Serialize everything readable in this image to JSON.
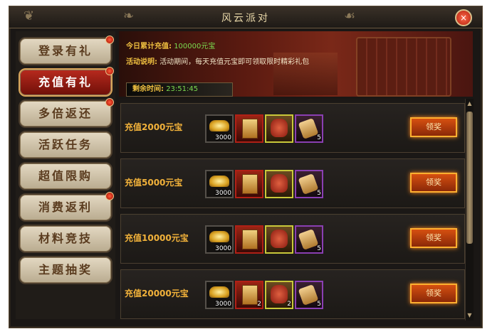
{
  "window": {
    "title": "风云派对",
    "close_label": "×"
  },
  "sidebar": {
    "items": [
      {
        "label": "登录有礼",
        "active": false,
        "dot": true
      },
      {
        "label": "充值有礼",
        "active": true,
        "dot": true
      },
      {
        "label": "多倍返还",
        "active": false,
        "dot": true
      },
      {
        "label": "活跃任务",
        "active": false,
        "dot": false
      },
      {
        "label": "超值限购",
        "active": false,
        "dot": false
      },
      {
        "label": "消费返利",
        "active": false,
        "dot": true
      },
      {
        "label": "材料竞技",
        "active": false,
        "dot": false
      },
      {
        "label": "主题抽奖",
        "active": false,
        "dot": false
      }
    ]
  },
  "banner": {
    "total_label": "今日累计充值:",
    "total_value": "100000元宝",
    "desc_label": "活动说明:",
    "desc_text": "活动期间，每天充值元宝即可领取限时精彩礼包",
    "timer_label": "剩余时间:",
    "timer_value": "23:51:45"
  },
  "rows": [
    {
      "label": "充值2000元宝",
      "items": [
        {
          "icon": "gold-ingot-icon",
          "qty": "3000"
        },
        {
          "icon": "scroll-icon",
          "qty": ""
        },
        {
          "icon": "red-bag-icon",
          "qty": ""
        },
        {
          "icon": "horn-icon",
          "qty": "5"
        }
      ],
      "claim": "领奖"
    },
    {
      "label": "充值5000元宝",
      "items": [
        {
          "icon": "gold-ingot-icon",
          "qty": "3000"
        },
        {
          "icon": "scroll-icon",
          "qty": ""
        },
        {
          "icon": "red-bag-icon",
          "qty": ""
        },
        {
          "icon": "horn-icon",
          "qty": "5"
        }
      ],
      "claim": "领奖"
    },
    {
      "label": "充值10000元宝",
      "items": [
        {
          "icon": "gold-ingot-icon",
          "qty": "3000"
        },
        {
          "icon": "scroll-icon",
          "qty": ""
        },
        {
          "icon": "red-bag-icon",
          "qty": ""
        },
        {
          "icon": "horn-icon",
          "qty": "5"
        }
      ],
      "claim": "领奖"
    },
    {
      "label": "充值20000元宝",
      "items": [
        {
          "icon": "gold-ingot-icon",
          "qty": "3000"
        },
        {
          "icon": "scroll-icon",
          "qty": "2"
        },
        {
          "icon": "red-bag-icon",
          "qty": "2"
        },
        {
          "icon": "horn-icon",
          "qty": "5"
        }
      ],
      "claim": "领奖"
    }
  ],
  "colors": {
    "accent": "#f2b23a",
    "active_tab": "#b82a1e",
    "value_green": "#7bdc50"
  }
}
